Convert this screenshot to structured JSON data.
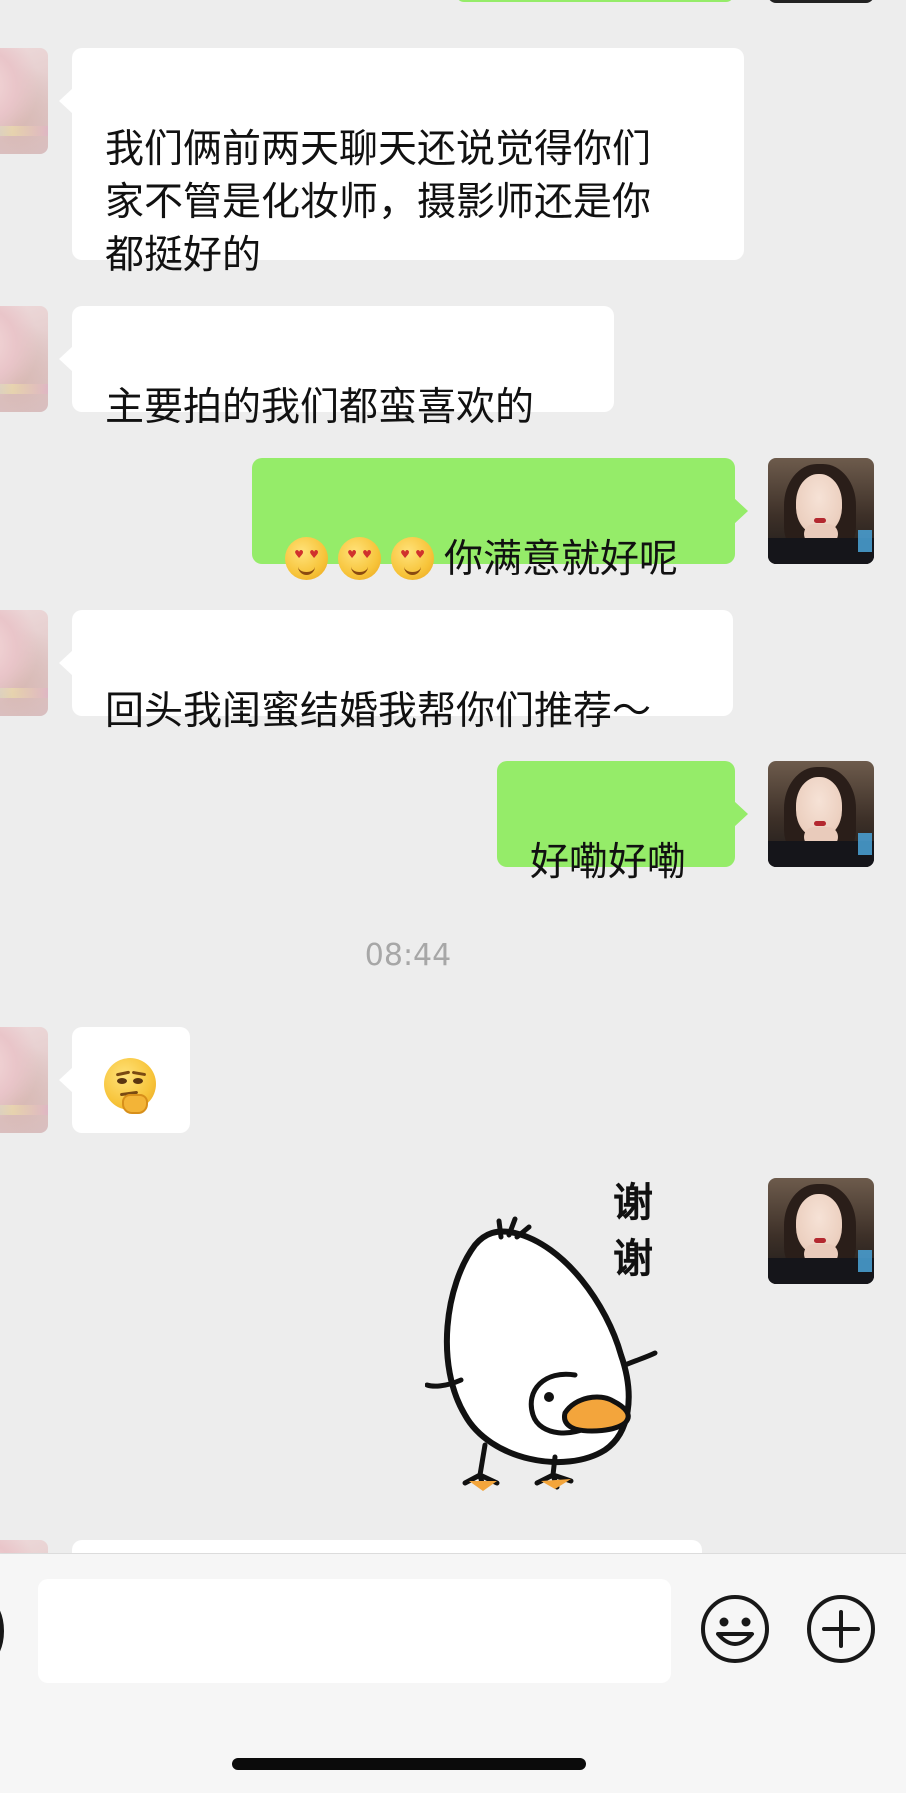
{
  "messages": [
    {
      "sender": "contact",
      "text": "我们俩前两天聊天还说觉得你们\n家不管是化妆师，摄影师还是你\n都挺好的"
    },
    {
      "sender": "contact",
      "text": "主要拍的我们都蛮喜欢的"
    },
    {
      "sender": "me",
      "emoji": "star-struck-emoji",
      "emoji_count": 3,
      "text": "你满意就好呢"
    },
    {
      "sender": "contact",
      "text": "回头我闺蜜结婚我帮你们推荐～"
    },
    {
      "sender": "me",
      "text": "好嘞好嘞"
    },
    {
      "sender": "contact",
      "emoji": "thinking-smirk-emoji"
    },
    {
      "sender": "me",
      "sticker": "duck-thanks-sticker",
      "sticker_text": "谢谢"
    }
  ],
  "timestamp": "08:44",
  "input_bar": {
    "text_value": "",
    "icons": [
      "voice-icon",
      "emoji-icon",
      "plus-icon"
    ]
  },
  "colors": {
    "background": "#ededed",
    "incoming_bubble": "#ffffff",
    "outgoing_bubble": "#95ec69",
    "timestamp": "#a7a7a7"
  }
}
